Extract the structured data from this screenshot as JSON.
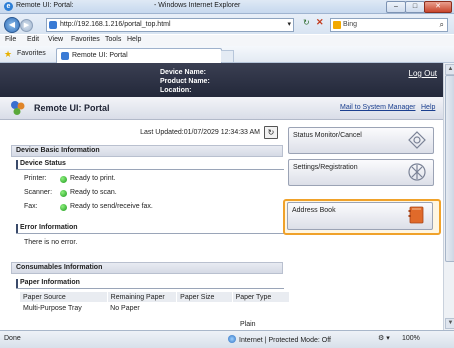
{
  "window": {
    "title_left": "Remote UI: Portal:",
    "title_right": "- Windows Internet Explorer",
    "min": "–",
    "max": "□",
    "close": "✕"
  },
  "nav": {
    "url": "http://192.168.1.216/portal_top.html",
    "search_placeholder": "Bing",
    "back": "◀",
    "forward": "▶",
    "dropdown": "▾",
    "refresh": "↻",
    "stop": "✕",
    "search_icon": "⌕"
  },
  "menu": [
    "File",
    "Edit",
    "View",
    "Favorites",
    "Tools",
    "Help"
  ],
  "favbar": {
    "favorites_label": "Favorites",
    "tab_label": "Remote UI: Portal"
  },
  "device": {
    "name_label": "Device Name:",
    "product_label": "Product Name:",
    "location_label": "Location:",
    "logout": "Log Out"
  },
  "portal": {
    "title": "Remote UI: Portal",
    "mail_link": "Mail to System Manager",
    "help_link": "Help",
    "last_updated": "Last Updated:01/07/2029 12:34:33 AM"
  },
  "basic": {
    "section_title": "Device Basic Information",
    "status_title": "Device Status",
    "rows": [
      {
        "label": "Printer:",
        "value": "Ready to print."
      },
      {
        "label": "Scanner:",
        "value": "Ready to scan."
      },
      {
        "label": "Fax:",
        "value": "Ready to send/receive fax."
      }
    ],
    "error_title": "Error Information",
    "error_text": "There is no error."
  },
  "consumables": {
    "section_title": "Consumables Information",
    "paper_title": "Paper Information",
    "columns": [
      "Paper Source",
      "Remaining Paper",
      "Paper Size",
      "Paper Type"
    ],
    "rows": [
      [
        "Multi-Purpose Tray",
        "No Paper",
        "",
        ""
      ]
    ],
    "overflow_text": "Plain"
  },
  "side_buttons": {
    "status_monitor": "Status Monitor/Cancel",
    "settings": "Settings/Registration",
    "address_book": "Address Book"
  },
  "statusbar": {
    "done": "Done",
    "zone": "Internet | Protected Mode: Off",
    "zoom": "100%",
    "icons": "⚙ ▾"
  }
}
